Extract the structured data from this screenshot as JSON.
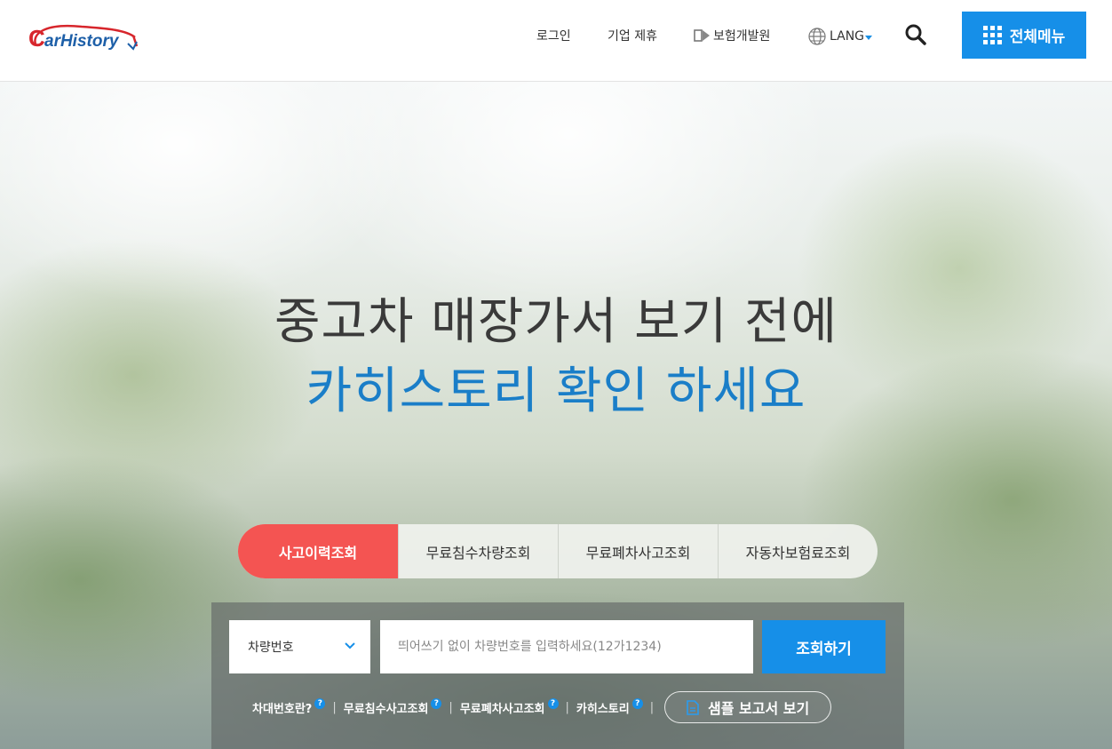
{
  "header": {
    "logo_text": "CarHistory",
    "nav": {
      "login": "로그인",
      "partner": "기업 제휴",
      "insurance": "보험개발원",
      "lang": "LANG"
    },
    "menu_label": "전체메뉴"
  },
  "hero": {
    "headline_line1": "중고차 매장가서 보기 전에",
    "headline_line2": "카히스토리 확인 하세요"
  },
  "tabs": [
    {
      "label": "사고이력조회",
      "active": true
    },
    {
      "label": "무료침수차량조회",
      "active": false
    },
    {
      "label": "무료폐차사고조회",
      "active": false
    },
    {
      "label": "자동차보험료조회",
      "active": false
    }
  ],
  "search": {
    "select_value": "차량번호",
    "placeholder": "띄어쓰기 없이 차량번호를 입력하세요(12가1234)",
    "button_label": "조회하기"
  },
  "help_links": [
    {
      "label": "차대번호란?"
    },
    {
      "label": "무료침수사고조회"
    },
    {
      "label": "무료폐차사고조회"
    },
    {
      "label": "카히스토리"
    }
  ],
  "help_marker": "?",
  "separator": "|",
  "sample_button": "샘플 보고서 보기",
  "colors": {
    "brand_blue": "#168fe8",
    "active_tab": "#f45452",
    "headline_blue": "#1a7ec8"
  },
  "icons": [
    "globe-icon",
    "search-icon",
    "grid-icon",
    "chevron-down-icon",
    "document-icon",
    "help-icon"
  ]
}
